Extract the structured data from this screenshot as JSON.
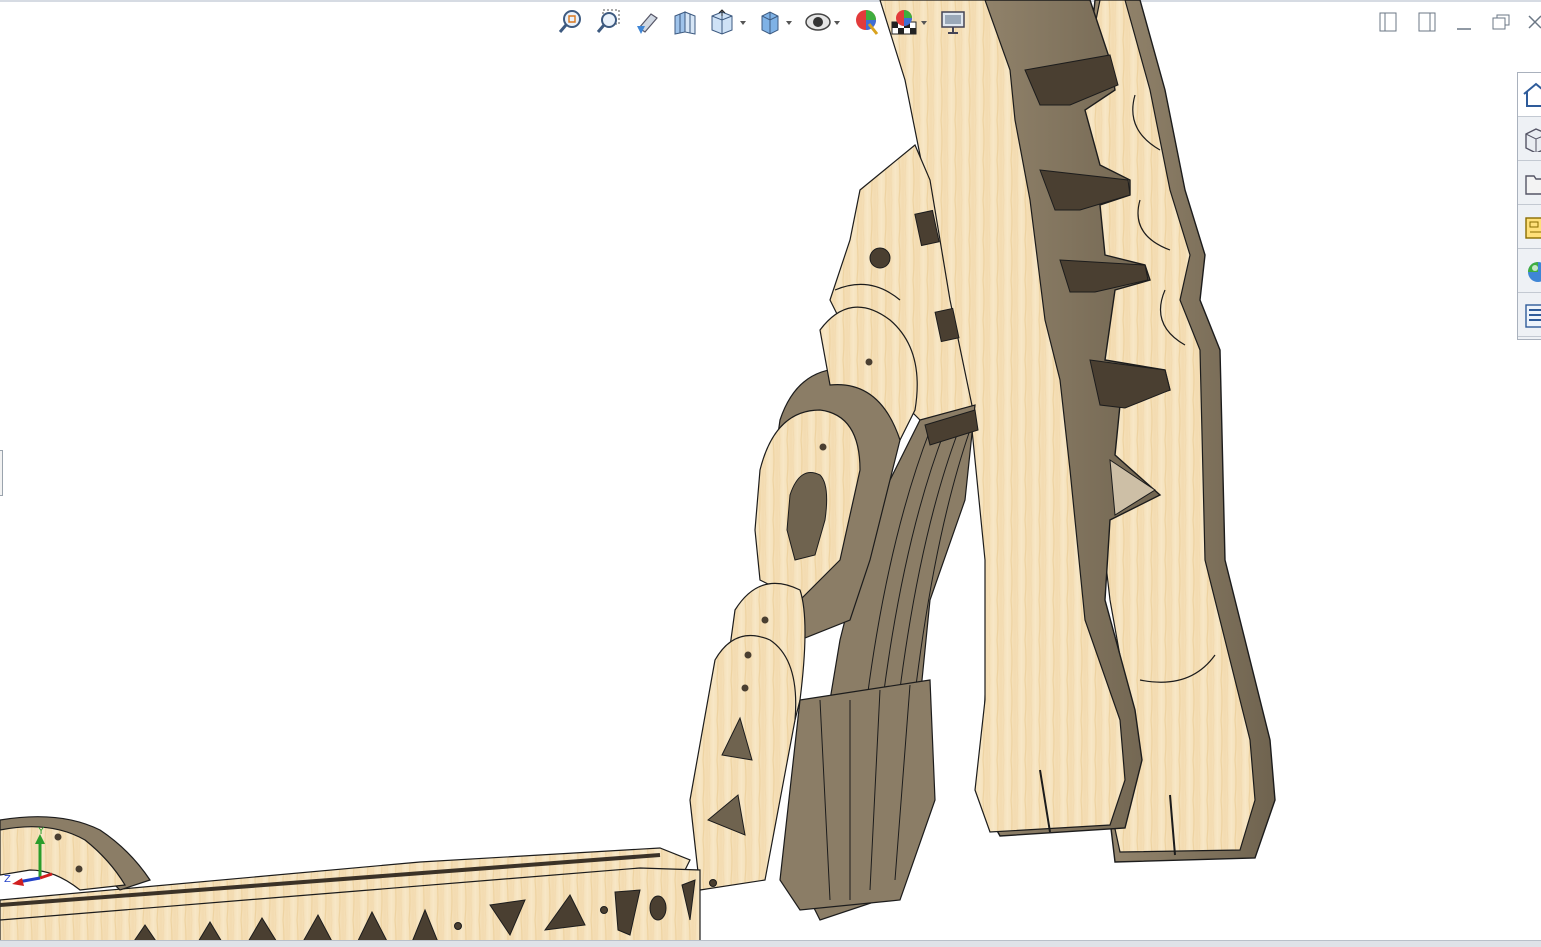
{
  "viewport": {
    "background": "#ffffff",
    "wood_light": "#f6e2bd",
    "wood_edge": "#8a7c66",
    "wood_shadow": "#4a3f31",
    "outline": "#1c1c1c"
  },
  "heads_up_toolbar": {
    "buttons": [
      {
        "icon": "zoom-to-fit-icon",
        "has_dropdown": false
      },
      {
        "icon": "zoom-to-area-icon",
        "has_dropdown": false
      },
      {
        "icon": "previous-view-icon",
        "has_dropdown": false
      },
      {
        "icon": "section-view-icon",
        "has_dropdown": false
      },
      {
        "icon": "view-orientation-icon",
        "has_dropdown": true
      },
      {
        "icon": "display-style-icon",
        "has_dropdown": true
      },
      {
        "icon": "hide-show-items-icon",
        "has_dropdown": true
      },
      {
        "icon": "edit-appearance-icon",
        "has_dropdown": false
      },
      {
        "icon": "apply-scene-icon",
        "has_dropdown": true
      },
      {
        "icon": "view-settings-icon",
        "has_dropdown": false
      }
    ]
  },
  "window_controls": [
    {
      "icon": "tile-left-icon"
    },
    {
      "icon": "tile-right-icon"
    },
    {
      "icon": "minimize-icon"
    },
    {
      "icon": "restore-icon"
    },
    {
      "icon": "close-icon"
    }
  ],
  "task_pane": {
    "tabs": [
      {
        "icon": "solidworks-resources-icon",
        "active": true
      },
      {
        "icon": "design-library-icon",
        "active": false
      },
      {
        "icon": "file-explorer-icon",
        "active": false
      },
      {
        "icon": "view-palette-icon",
        "active": false
      },
      {
        "icon": "appearances-scenes-icon",
        "active": false
      },
      {
        "icon": "custom-properties-icon",
        "active": false
      }
    ]
  },
  "triad": {
    "x_color": "#d11f1f",
    "y_color": "#2a9d2a",
    "z_color": "#2442c8",
    "y_label": "Y",
    "z_label": "Z"
  }
}
